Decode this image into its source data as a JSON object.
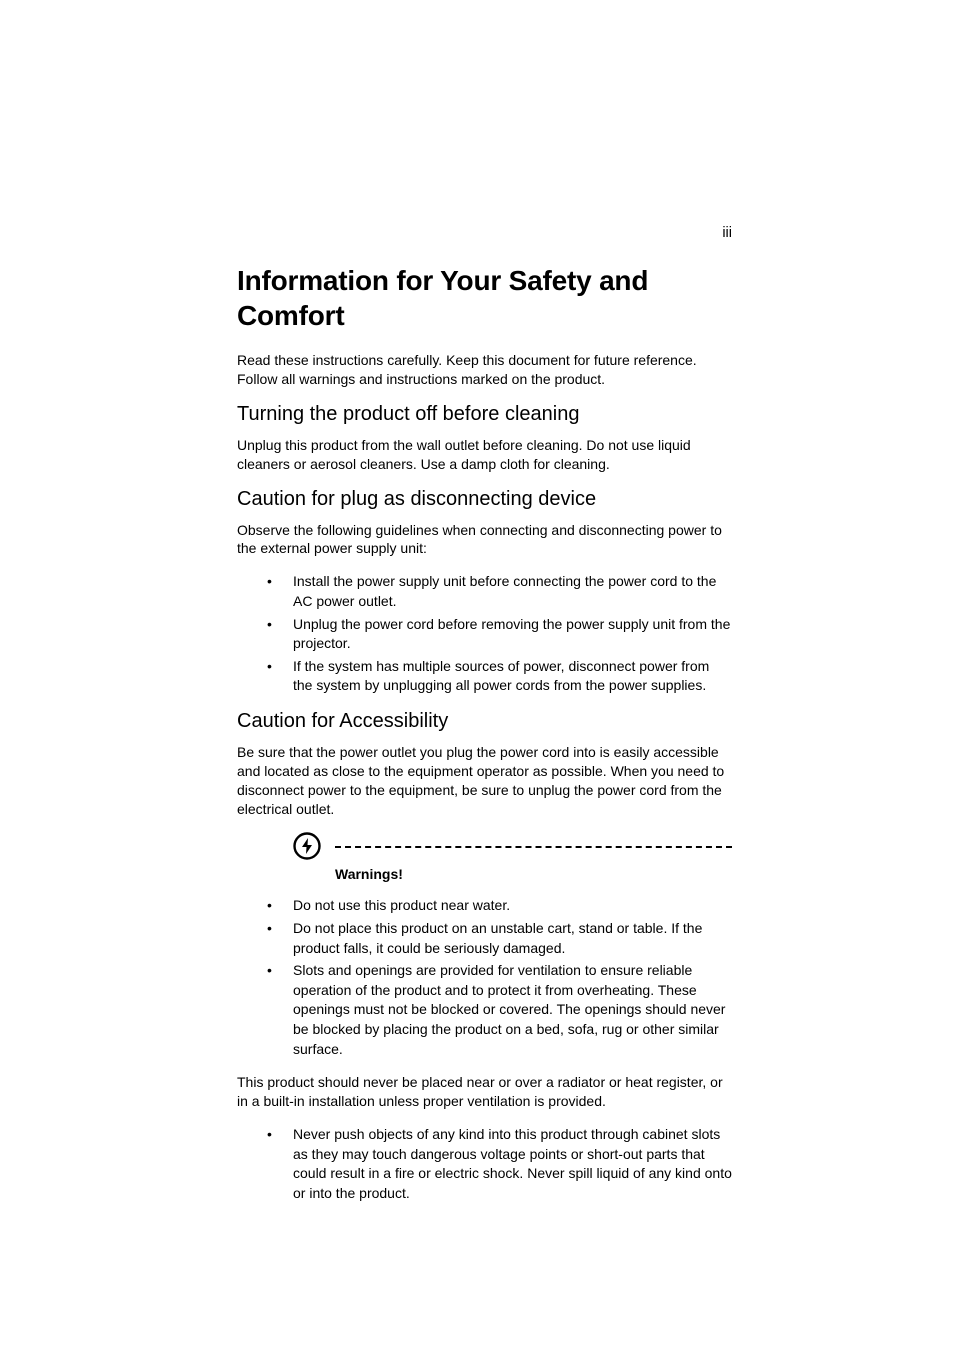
{
  "page_number": "iii",
  "title": "Information for Your Safety and Comfort",
  "intro": "Read these instructions carefully. Keep this document for future reference. Follow all warnings and instructions marked on the product.",
  "sections": [
    {
      "heading": "Turning the product off before cleaning",
      "body": "Unplug this product from the wall outlet before cleaning. Do not use liquid cleaners or aerosol cleaners. Use a damp cloth for cleaning."
    },
    {
      "heading": "Caution for plug as disconnecting device",
      "body": "Observe the following guidelines when connecting and disconnecting power to the external power supply unit:",
      "bullets": [
        "Install the power supply unit before connecting the power cord to the AC power outlet.",
        "Unplug the power cord before removing the power supply unit from the projector.",
        "If the system has multiple sources of power, disconnect power from the system by unplugging all power cords from the power supplies."
      ]
    },
    {
      "heading": "Caution for Accessibility",
      "body": "Be sure that the power outlet you plug the power cord into is easily accessible and located as close to the equipment operator as possible. When you need to disconnect power to the equipment, be sure to unplug the power cord from the electrical outlet."
    }
  ],
  "warning_label": "Warnings!",
  "warning_bullets_1": [
    "Do not use this product near water.",
    "Do not place this product on an unstable cart, stand or table. If the product falls, it could be seriously damaged.",
    "Slots and openings are provided for ventilation to ensure reliable operation of the product and to protect it from overheating. These openings must not be blocked or covered. The openings should never be blocked by placing the product on a bed, sofa, rug or other similar surface."
  ],
  "warning_paragraph": "This product should never be placed near or over a radiator or heat register, or in a built-in installation unless proper ventilation is provided.",
  "warning_bullets_2": [
    "Never push objects of any kind into this product through cabinet slots as they may touch dangerous voltage points or short-out parts that could result in a fire or electric shock. Never spill liquid of any kind onto or into the product."
  ]
}
